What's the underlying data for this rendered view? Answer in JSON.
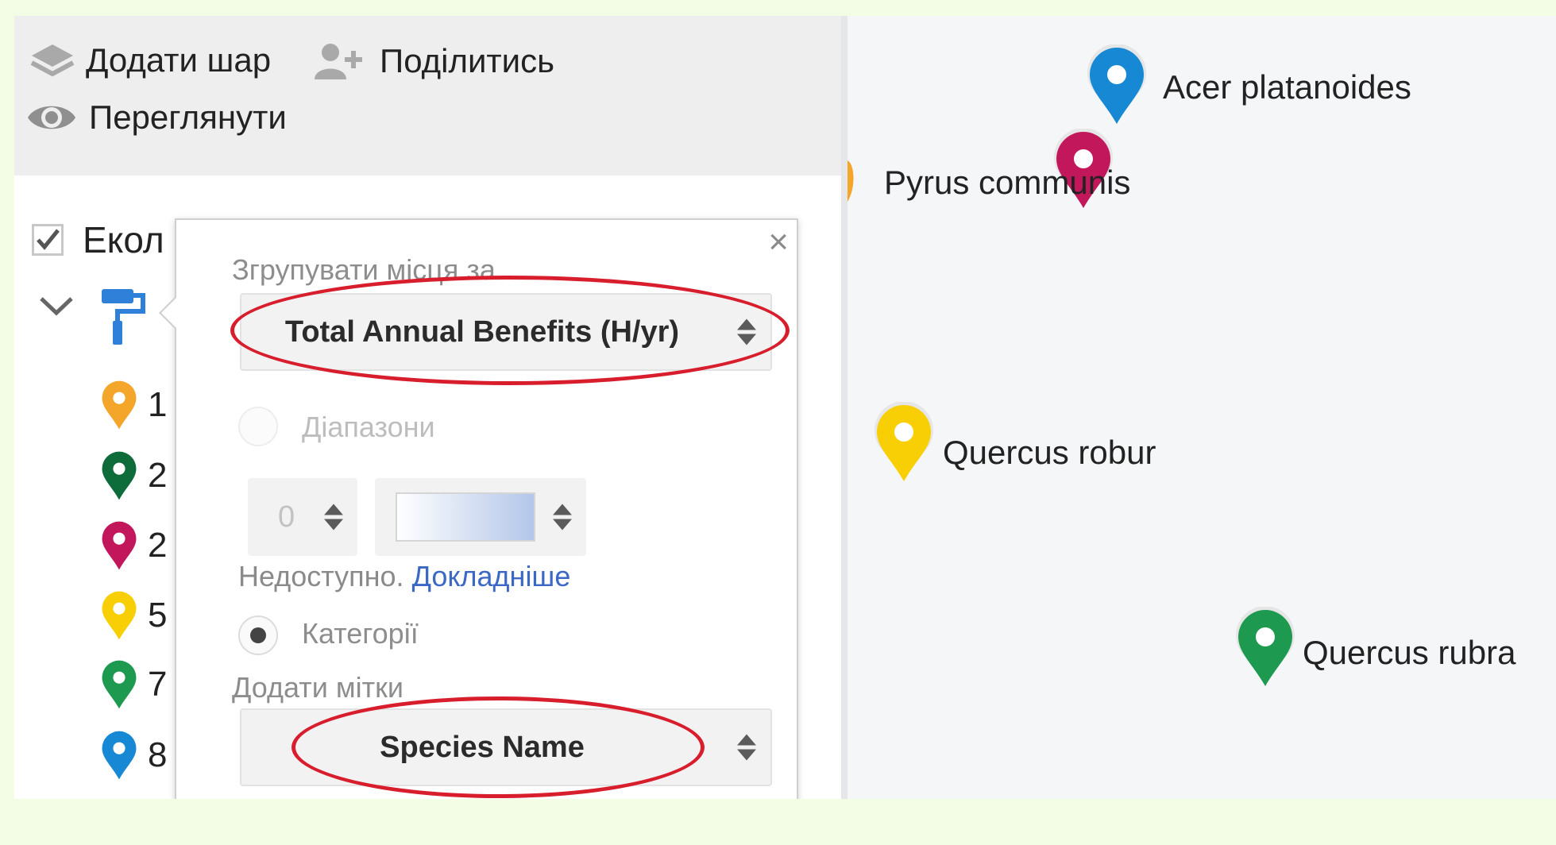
{
  "toolbar": {
    "add_layer": "Додати шар",
    "share": "Поділитись",
    "preview": "Переглянути"
  },
  "layer": {
    "name_visible": "Екол",
    "checked": true
  },
  "legend": [
    {
      "num": "1",
      "color": "#f4a62a"
    },
    {
      "num": "2",
      "color": "#0e6b3a"
    },
    {
      "num": "2",
      "color": "#c2185b"
    },
    {
      "num": "5",
      "color": "#f8cf05"
    },
    {
      "num": "7",
      "color": "#1e9a50"
    },
    {
      "num": "8",
      "color": "#1688d4"
    }
  ],
  "style_popup": {
    "close": "×",
    "group_by_label": "Згрупувати місця за",
    "group_by_value": "Total Annual Benefits (H/yr)",
    "ranges_label": "Діапазони",
    "range_count": "0",
    "unavailable_text": "Недоступно.",
    "learn_more": "Докладніше",
    "categories_label": "Категорії",
    "labels_label": "Додати мітки",
    "labels_value": "Species Name"
  },
  "map": {
    "markers": [
      {
        "label": "Acer platanoides",
        "color": "#1688d4"
      },
      {
        "label": "Pyrus communis",
        "color": "#c2185b"
      },
      {
        "label": "Quercus robur",
        "color": "#f8cf05"
      },
      {
        "label": "Quercus rubra",
        "color": "#1e9a50"
      }
    ]
  },
  "colors": {
    "highlight": "#d81e2c",
    "link": "#3a68c4",
    "page_border": "#f3fde6"
  }
}
